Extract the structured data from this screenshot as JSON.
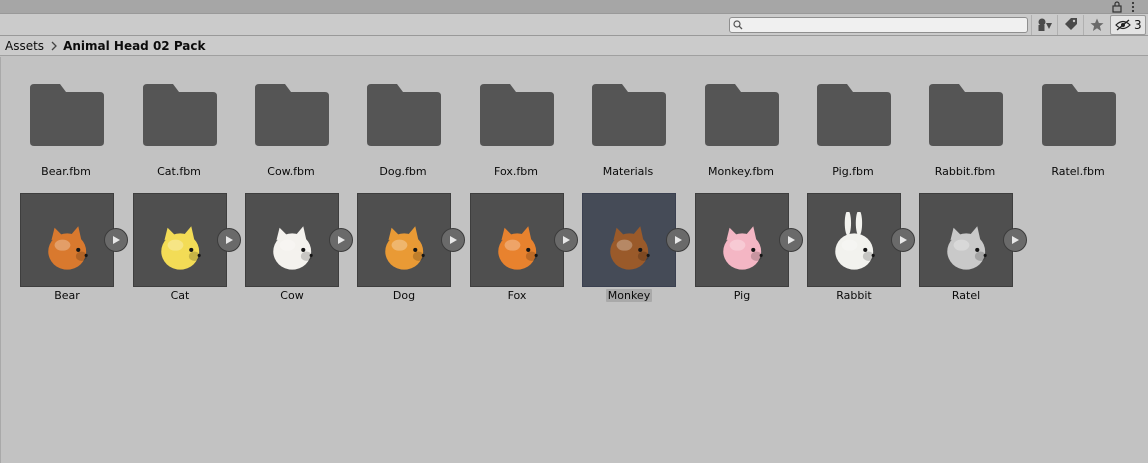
{
  "header": {
    "hidden_count": "3"
  },
  "search": {
    "placeholder": "",
    "value": ""
  },
  "breadcrumb": {
    "root": "Assets",
    "current": "Animal Head 02 Pack"
  },
  "folders": [
    {
      "label": "Bear.fbm"
    },
    {
      "label": "Cat.fbm"
    },
    {
      "label": "Cow.fbm"
    },
    {
      "label": "Dog.fbm"
    },
    {
      "label": "Fox.fbm"
    },
    {
      "label": "Materials"
    },
    {
      "label": "Monkey.fbm"
    },
    {
      "label": "Pig.fbm"
    },
    {
      "label": "Rabbit.fbm"
    },
    {
      "label": "Ratel.fbm"
    }
  ],
  "models": [
    {
      "label": "Bear",
      "color": "#d9792e"
    },
    {
      "label": "Cat",
      "color": "#f3dc56"
    },
    {
      "label": "Cow",
      "color": "#f4f2ee"
    },
    {
      "label": "Dog",
      "color": "#e99a35"
    },
    {
      "label": "Fox",
      "color": "#e8822e"
    },
    {
      "label": "Monkey",
      "color": "#9a5a2a",
      "selected": true
    },
    {
      "label": "Pig",
      "color": "#f4b6c4"
    },
    {
      "label": "Rabbit",
      "color": "#f2f2ee"
    },
    {
      "label": "Ratel",
      "color": "#c9c9c9"
    }
  ],
  "colors": {
    "folder": "#555555",
    "thumb_bg": "#4f4f4f",
    "selected_bg": "#454b57"
  },
  "icons": [
    "lock-icon",
    "kebab-menu-icon",
    "search-icon",
    "filter-by-type-icon",
    "filter-by-label-icon",
    "favorite-star-icon",
    "hidden-eye-icon",
    "chevron-right-icon",
    "folder-icon",
    "play-icon"
  ]
}
